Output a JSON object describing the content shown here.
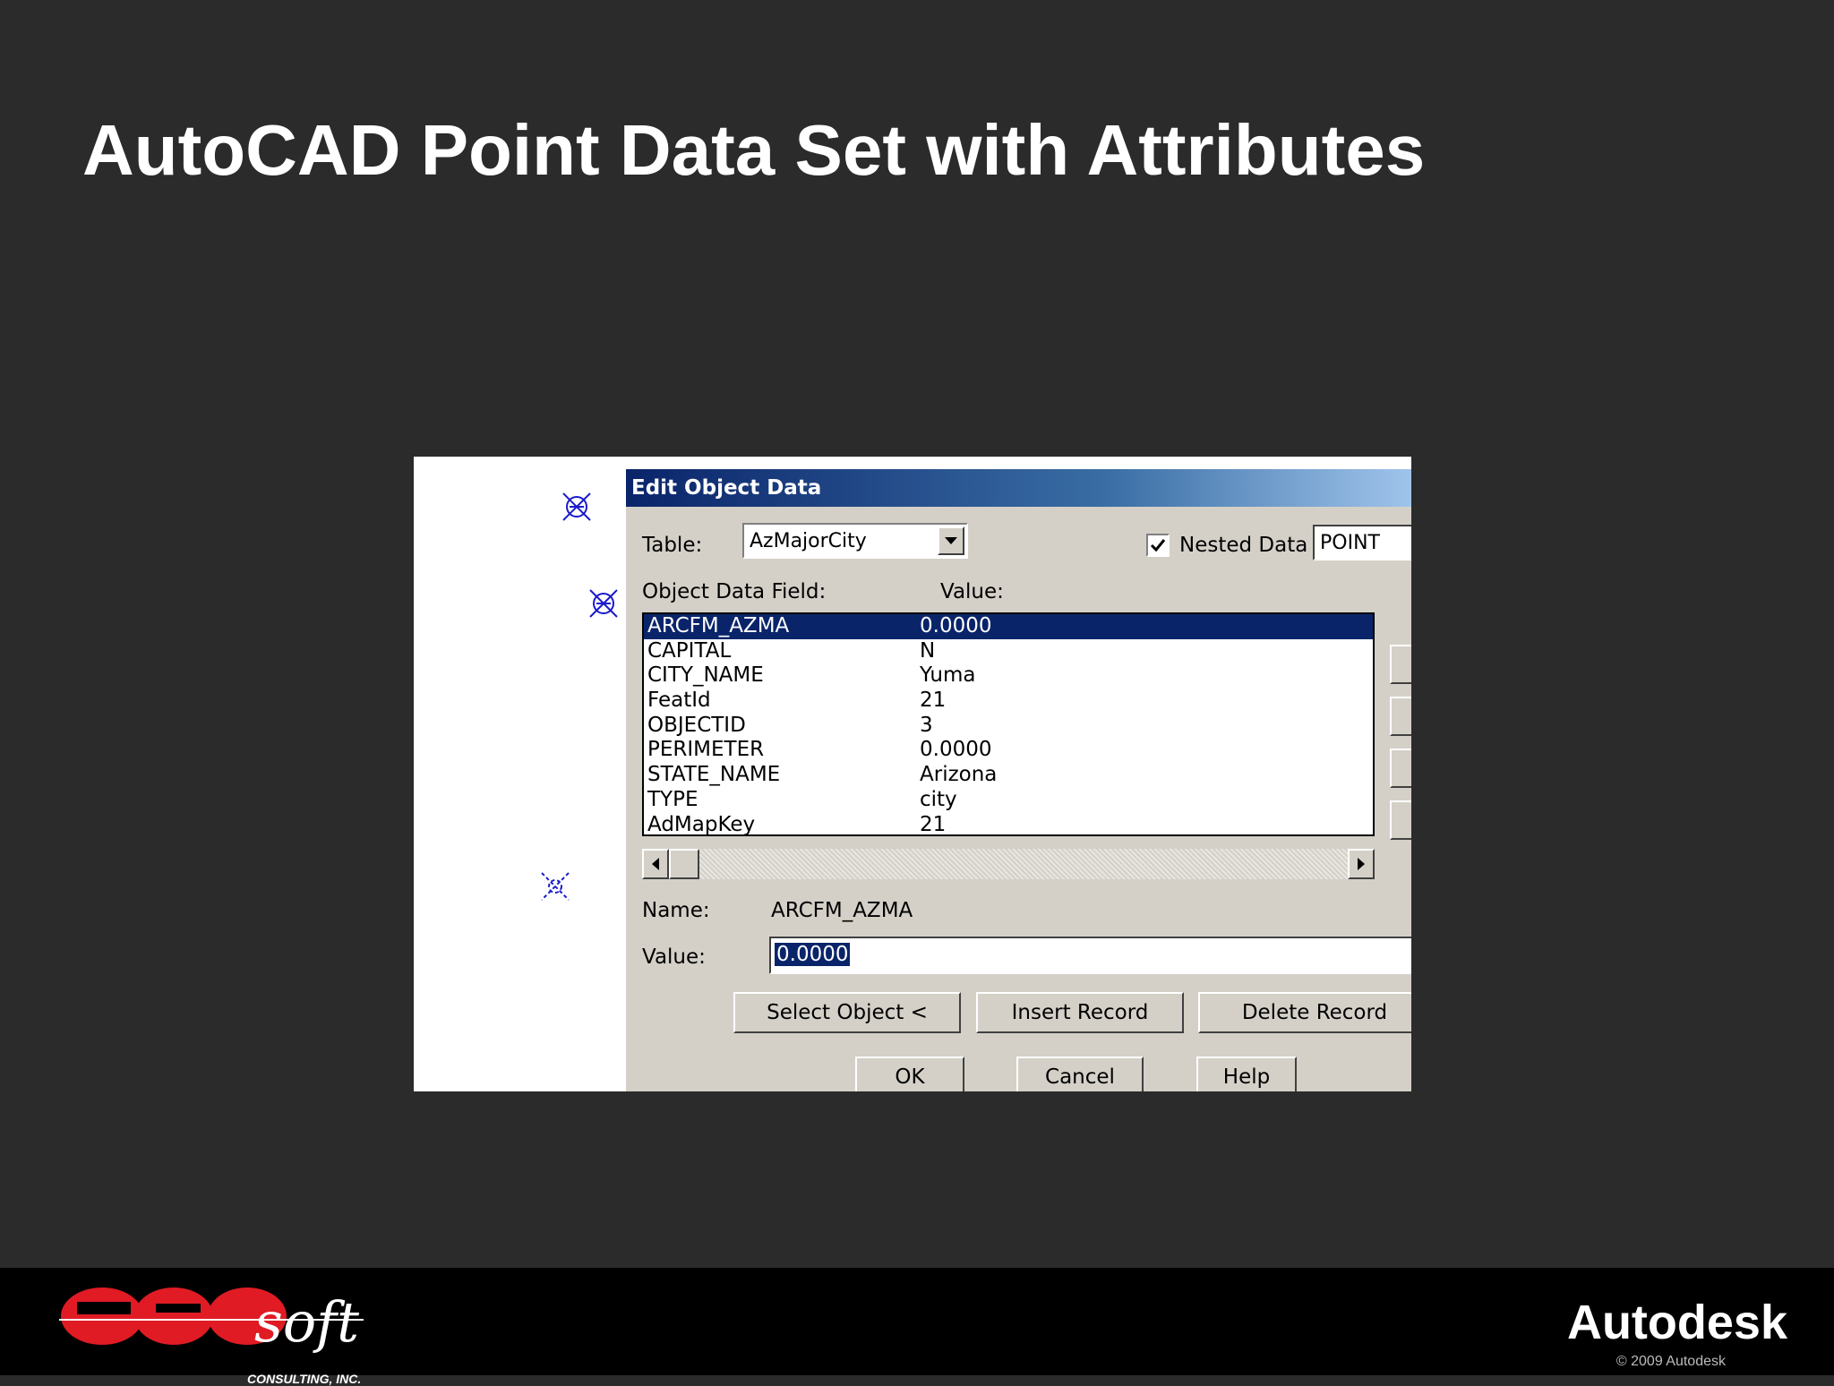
{
  "slide": {
    "title": "AutoCAD Point Data Set with Attributes"
  },
  "dialog": {
    "title": "Edit Object Data",
    "table_label": "Table:",
    "table_value": "AzMajorCity",
    "nested_data_label": "Nested Data",
    "nested_data_checked": true,
    "point_value": "POINT",
    "field_header": "Object Data Field:",
    "value_header": "Value:",
    "rows": [
      {
        "field": "ARCFM_AZMA",
        "value": "0.0000"
      },
      {
        "field": "CAPITAL",
        "value": "N"
      },
      {
        "field": "CITY_NAME",
        "value": "Yuma"
      },
      {
        "field": "FeatId",
        "value": "21"
      },
      {
        "field": "OBJECTID",
        "value": "3"
      },
      {
        "field": "PERIMETER",
        "value": "0.0000"
      },
      {
        "field": "STATE_NAME",
        "value": "Arizona"
      },
      {
        "field": "TYPE",
        "value": "city"
      },
      {
        "field": "AdMapKey",
        "value": "21"
      }
    ],
    "name_label": "Name:",
    "name_value": "ARCFM_AZMA",
    "value_label": "Value:",
    "value_value": "0.0000",
    "buttons": {
      "select_object": "Select Object <",
      "insert_record": "Insert Record",
      "delete_record": "Delete Record",
      "ok": "OK",
      "cancel": "Cancel",
      "help": "Help"
    }
  },
  "footer": {
    "cadsoft_text": "soft",
    "cadsoft_sub": "CONSULTING, INC.",
    "autodesk": "Autodesk",
    "copyright": "© 2009 Autodesk"
  },
  "colors": {
    "background": "#2b2b2b",
    "selection": "#0a246a",
    "dialog": "#d4d0c8",
    "cad_marker": "#1a1acc",
    "cadsoft_red": "#e01b24"
  }
}
